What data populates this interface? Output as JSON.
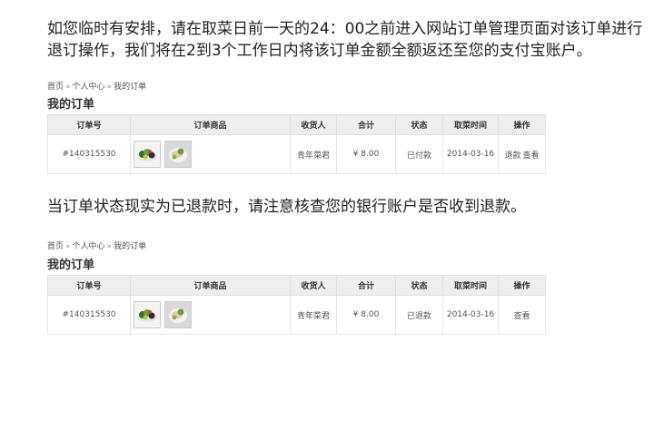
{
  "notice": {
    "para1": "如您临时有安排，请在取菜日前一天的24：00之前进入网站订单管理页面对该订单进行退订操作，我们将在2到3个工作日内将该订单金额全额返还至您的支付宝账户。",
    "para2": "当订单状态现实为已退款时，请注意核查您的银行账户是否收到退款。"
  },
  "breadcrumb": {
    "home": "首页",
    "sep": "»",
    "center": "个人中心",
    "orders": "我的订单"
  },
  "section_title": "我的订单",
  "table_headers": [
    "订单号",
    "订单商品",
    "收货人",
    "合计",
    "状态",
    "取菜时间",
    "操作"
  ],
  "screens": [
    {
      "order": {
        "id": "#140315530",
        "receiver": "青年菜君",
        "total": "¥ 8.00",
        "status": "已付款",
        "pickup_date": "2014-03-16",
        "actions": [
          "退款",
          "查看"
        ]
      }
    },
    {
      "order": {
        "id": "#140315530",
        "receiver": "青年菜君",
        "total": "¥ 8.00",
        "status": "已退款",
        "pickup_date": "2014-03-16",
        "actions": [
          "查看"
        ]
      }
    }
  ],
  "icons": {
    "thumb1": "salad-dish-thumbnail",
    "thumb2": "fish-dish-thumbnail"
  }
}
